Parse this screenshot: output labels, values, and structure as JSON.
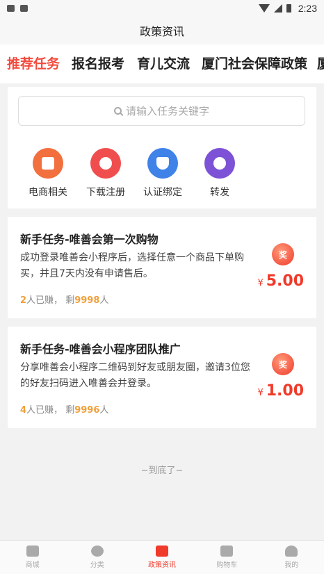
{
  "status_bar": {
    "time": "2:23"
  },
  "header": {
    "title": "政策资讯"
  },
  "tabs": [
    {
      "label": "推荐任务",
      "active": true
    },
    {
      "label": "报名报考",
      "active": false
    },
    {
      "label": "育儿交流",
      "active": false
    },
    {
      "label": "厦门社会保障政策",
      "active": false
    },
    {
      "label": "厦",
      "active": false
    }
  ],
  "search": {
    "placeholder": "请输入任务关键字"
  },
  "categories": [
    {
      "label": "电商相关",
      "icon": "bag-icon",
      "color": "#f26f3e"
    },
    {
      "label": "下载注册",
      "icon": "user-add-icon",
      "color": "#f04e4e"
    },
    {
      "label": "认证绑定",
      "icon": "shield-check-icon",
      "color": "#3f82e8"
    },
    {
      "label": "转发",
      "icon": "share-arrow-icon",
      "color": "#7d52d6"
    }
  ],
  "tasks": [
    {
      "title": "新手任务-唯善会第一次购物",
      "description": "成功登录唯善会小程序后，选择任意一个商品下单购买，并且7天内没有申请售后。",
      "earned_count": "2",
      "earned_suffix": "人已赚，",
      "remaining_prefix": "剩",
      "remaining_count": "9998",
      "remaining_suffix": "人",
      "badge": "奖",
      "currency": "¥",
      "price": "5.00"
    },
    {
      "title": "新手任务-唯善会小程序团队推广",
      "description": "分享唯善会小程序二维码到好友或朋友圈，邀请3位您的好友扫码进入唯善会并登录。",
      "earned_count": "4",
      "earned_suffix": "人已赚，",
      "remaining_prefix": "剩",
      "remaining_count": "9996",
      "remaining_suffix": "人",
      "badge": "奖",
      "currency": "¥",
      "price": "1.00"
    }
  ],
  "footer_note": "~到底了~",
  "bottom_nav": [
    {
      "label": "商城",
      "icon": "home-icon",
      "active": false
    },
    {
      "label": "分类",
      "icon": "grid-icon",
      "active": false
    },
    {
      "label": "政策资讯",
      "icon": "tv-icon",
      "active": true
    },
    {
      "label": "购物车",
      "icon": "cart-icon",
      "active": false
    },
    {
      "label": "我的",
      "icon": "person-icon",
      "active": false
    }
  ],
  "colors": {
    "accent": "#f24a3d",
    "price": "#f03a2a",
    "stat_highlight": "#f0a03a"
  }
}
